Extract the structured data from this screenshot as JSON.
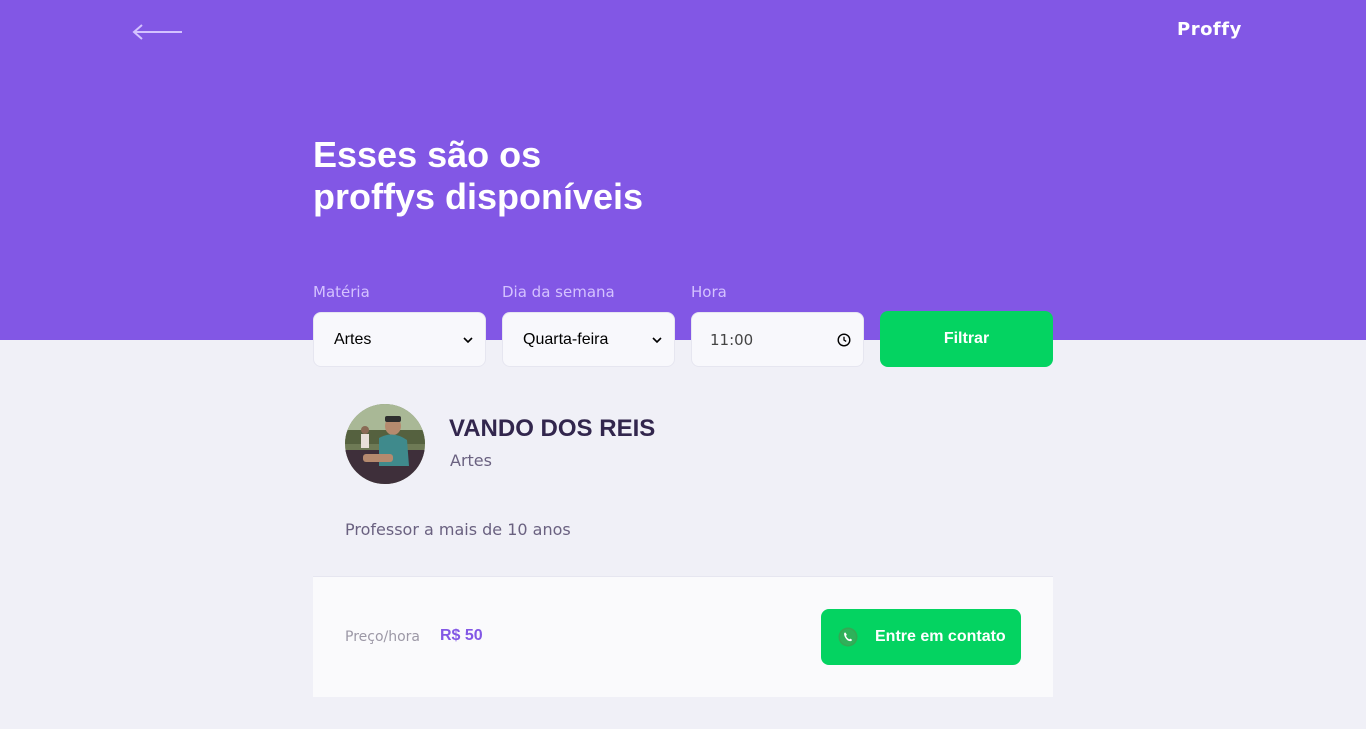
{
  "header": {
    "logo": "Proffy",
    "title_line1": "Esses são os",
    "title_line2": "proffys disponíveis",
    "back_icon": "arrow-left-icon"
  },
  "filters": {
    "subject_label": "Matéria",
    "subject_value": "Artes",
    "weekday_label": "Dia da semana",
    "weekday_value": "Quarta-feira",
    "time_label": "Hora",
    "time_value": "11:00",
    "submit_label": "Filtrar"
  },
  "teacher": {
    "name": "VANDO DOS REIS",
    "subject": "Artes",
    "bio": "Professor a mais de 10 anos",
    "price_label": "Preço/hora",
    "price_value": "R$ 50",
    "contact_label": "Entre em contato",
    "contact_icon": "whatsapp-icon"
  },
  "colors": {
    "primary": "#8257E5",
    "secondary": "#04D361",
    "background": "#F0F0F7",
    "title_text": "#32264D"
  }
}
